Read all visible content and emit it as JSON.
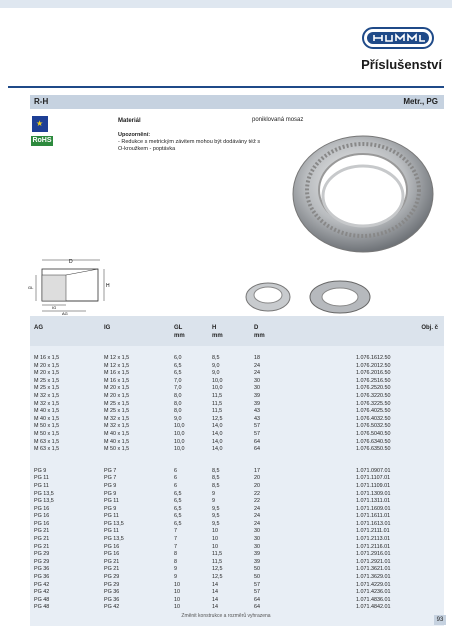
{
  "header": {
    "title": "Příslušenství"
  },
  "section": {
    "left": "R-H",
    "right": "Metr., PG"
  },
  "badges": {
    "rohs": "RoHS"
  },
  "material": {
    "label": "Materiál",
    "value": "poniklovaná mosaz"
  },
  "note": {
    "label": "Upozornění:",
    "line1": "- Redukce s metrickým závitem mohou být dodávány též s",
    "line2": "O-kroužkem - poptávka"
  },
  "drawing": {
    "d": "D",
    "h": "H",
    "gl": "GL",
    "ig": "IG",
    "ag": "AG"
  },
  "table": {
    "headers": {
      "ag": "AG",
      "ig": "IG",
      "gl": "GL",
      "h": "H",
      "d": "D",
      "obj": "Obj. č"
    },
    "units": {
      "gl": "mm",
      "h": "mm",
      "d": "mm"
    },
    "metric_rows": [
      [
        "M 16 x 1,5",
        "M 12 x 1,5",
        "6,0",
        "8,5",
        "18",
        "1.076.1612.50"
      ],
      [
        "M 20 x 1,5",
        "M 12 x 1,5",
        "6,5",
        "9,0",
        "24",
        "1.076.2012.50"
      ],
      [
        "M 20 x 1,5",
        "M 16 x 1,5",
        "6,5",
        "9,0",
        "24",
        "1.076.2016.50"
      ],
      [
        "M 25 x 1,5",
        "M 16 x 1,5",
        "7,0",
        "10,0",
        "30",
        "1.076.2516.50"
      ],
      [
        "M 25 x 1,5",
        "M 20 x 1,5",
        "7,0",
        "10,0",
        "30",
        "1.076.2520.50"
      ],
      [
        "M 32 x 1,5",
        "M 20 x 1,5",
        "8,0",
        "11,5",
        "39",
        "1.076.3220.50"
      ],
      [
        "M 32 x 1,5",
        "M 25 x 1,5",
        "8,0",
        "11,5",
        "39",
        "1.076.3225.50"
      ],
      [
        "M 40 x 1,5",
        "M 25 x 1,5",
        "8,0",
        "11,5",
        "43",
        "1.076.4025.50"
      ],
      [
        "M 40 x 1,5",
        "M 32 x 1,5",
        "9,0",
        "12,5",
        "43",
        "1.076.4032.50"
      ],
      [
        "M 50 x 1,5",
        "M 32 x 1,5",
        "10,0",
        "14,0",
        "57",
        "1.076.5032.50"
      ],
      [
        "M 50 x 1,5",
        "M 40 x 1,5",
        "10,0",
        "14,0",
        "57",
        "1.076.5040.50"
      ],
      [
        "M 63 x 1,5",
        "M 40 x 1,5",
        "10,0",
        "14,0",
        "64",
        "1.076.6340.50"
      ],
      [
        "M 63 x 1,5",
        "M 50 x 1,5",
        "10,0",
        "14,0",
        "64",
        "1.076.6350.50"
      ]
    ],
    "pg_rows": [
      [
        "PG 9",
        "PG 7",
        "6",
        "8,5",
        "17",
        "1.071.0907.01"
      ],
      [
        "PG 11",
        "PG 7",
        "6",
        "8,5",
        "20",
        "1.071.1107.01"
      ],
      [
        "PG 11",
        "PG 9",
        "6",
        "8,5",
        "20",
        "1.071.1109.01"
      ],
      [
        "PG 13,5",
        "PG 9",
        "6,5",
        "9",
        "22",
        "1.071.1309.01"
      ],
      [
        "PG 13,5",
        "PG 11",
        "6,5",
        "9",
        "22",
        "1.071.1311.01"
      ],
      [
        "PG 16",
        "PG 9",
        "6,5",
        "9,5",
        "24",
        "1.071.1609.01"
      ],
      [
        "PG 16",
        "PG 11",
        "6,5",
        "9,5",
        "24",
        "1.071.1611.01"
      ],
      [
        "PG 16",
        "PG 13,5",
        "6,5",
        "9,5",
        "24",
        "1.071.1613.01"
      ],
      [
        "PG 21",
        "PG 11",
        "7",
        "10",
        "30",
        "1.071.2111.01"
      ],
      [
        "PG 21",
        "PG 13,5",
        "7",
        "10",
        "30",
        "1.071.2113.01"
      ],
      [
        "PG 21",
        "PG 16",
        "7",
        "10",
        "30",
        "1.071.2116.01"
      ],
      [
        "PG 29",
        "PG 16",
        "8",
        "11,5",
        "39",
        "1.071.2916.01"
      ],
      [
        "PG 29",
        "PG 21",
        "8",
        "11,5",
        "39",
        "1.071.2921.01"
      ],
      [
        "PG 36",
        "PG 21",
        "9",
        "12,5",
        "50",
        "1.071.3621.01"
      ],
      [
        "PG 36",
        "PG 29",
        "9",
        "12,5",
        "50",
        "1.071.3629.01"
      ],
      [
        "PG 42",
        "PG 29",
        "10",
        "14",
        "57",
        "1.071.4229.01"
      ],
      [
        "PG 42",
        "PG 36",
        "10",
        "14",
        "57",
        "1.071.4236.01"
      ],
      [
        "PG 48",
        "PG 36",
        "10",
        "14",
        "64",
        "1.071.4836.01"
      ],
      [
        "PG 48",
        "PG 42",
        "10",
        "14",
        "64",
        "1.071.4842.01"
      ]
    ]
  },
  "footer": {
    "text": "Změnit konstrukce a rozměrů vyhrazena",
    "page": "93"
  },
  "colors": {
    "accent": "#1f4a88",
    "band": "#e8eef5",
    "header_band": "#c6d2e0"
  }
}
